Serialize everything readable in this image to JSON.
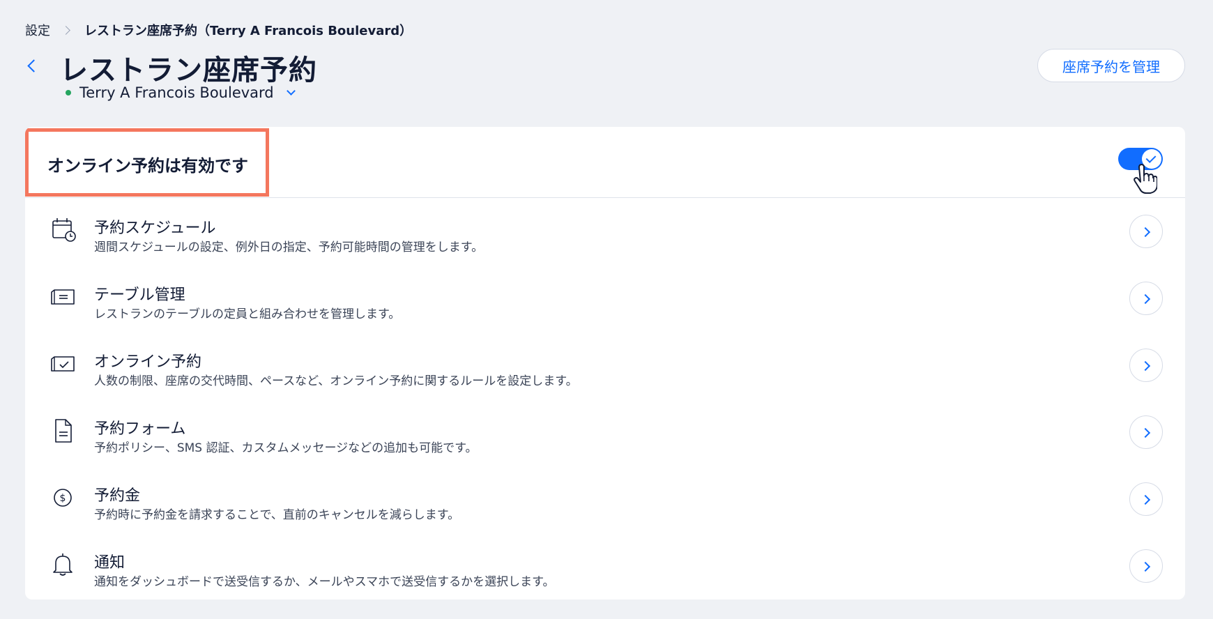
{
  "breadcrumb": {
    "root": "設定",
    "current": "レストラン座席予約（Terry A Francois Boulevard）"
  },
  "header": {
    "title": "レストラン座席予約",
    "location": "Terry A Francois Boulevard",
    "location_status_color": "#25a55f",
    "manage_button": "座席予約を管理"
  },
  "card": {
    "title": "オンライン予約は有効です",
    "toggle_on": true,
    "accent_color": "#116dff",
    "highlight_color": "#f4775e",
    "rows": [
      {
        "icon": "calendar-clock-icon",
        "label": "予約スケジュール",
        "desc": "週間スケジュールの設定、例外日の指定、予約可能時間の管理をします。"
      },
      {
        "icon": "table-icon",
        "label": "テーブル管理",
        "desc": "レストランのテーブルの定員と組み合わせを管理します。"
      },
      {
        "icon": "online-reservation-icon",
        "label": "オンライン予約",
        "desc": "人数の制限、座席の交代時間、ペースなど、オンライン予約に関するルールを設定します。"
      },
      {
        "icon": "document-icon",
        "label": "予約フォーム",
        "desc": "予約ポリシー、SMS 認証、カスタムメッセージなどの追加も可能です。"
      },
      {
        "icon": "dollar-coin-icon",
        "label": "予約金",
        "desc": "予約時に予約金を請求することで、直前のキャンセルを減らします。"
      },
      {
        "icon": "bell-icon",
        "label": "通知",
        "desc": "通知をダッシュボードで送受信するか、メールやスマホで送受信するかを選択します。"
      }
    ]
  }
}
